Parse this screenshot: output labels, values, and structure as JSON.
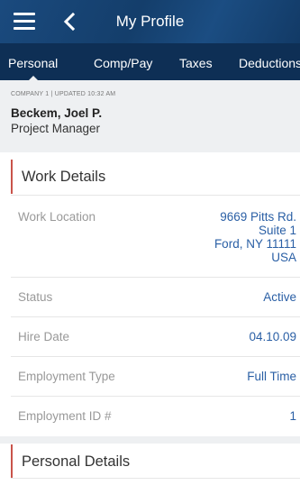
{
  "header": {
    "title": "My Profile",
    "menu_icon": "hamburger-menu-icon",
    "back_icon": "chevron-left-icon",
    "background_color": "#143e6b"
  },
  "tabs": [
    {
      "label": "Personal",
      "active": true
    },
    {
      "label": "Comp/Pay",
      "active": false
    },
    {
      "label": "Taxes",
      "active": false
    },
    {
      "label": "Deductions",
      "active": false
    }
  ],
  "profile": {
    "meta": "COMPANY 1 | UPDATED 10:32 AM",
    "name": "Beckem, Joel P.",
    "role": "Project Manager"
  },
  "work_details": {
    "title": "Work Details",
    "rows": [
      {
        "label": "Work Location",
        "value_lines": [
          "9669 Pitts Rd.",
          "Suite 1",
          "Ford, NY 11111",
          "USA"
        ]
      },
      {
        "label": "Status",
        "value": "Active"
      },
      {
        "label": "Hire Date",
        "value": "04.10.09"
      },
      {
        "label": "Employment Type",
        "value": "Full Time"
      },
      {
        "label": "Employment ID #",
        "value": "1"
      }
    ]
  },
  "personal_details": {
    "title": "Personal Details"
  },
  "colors": {
    "accent_bar": "#c9534a",
    "link_value": "#2a5fa5",
    "tab_bar": "#0e2f55"
  }
}
